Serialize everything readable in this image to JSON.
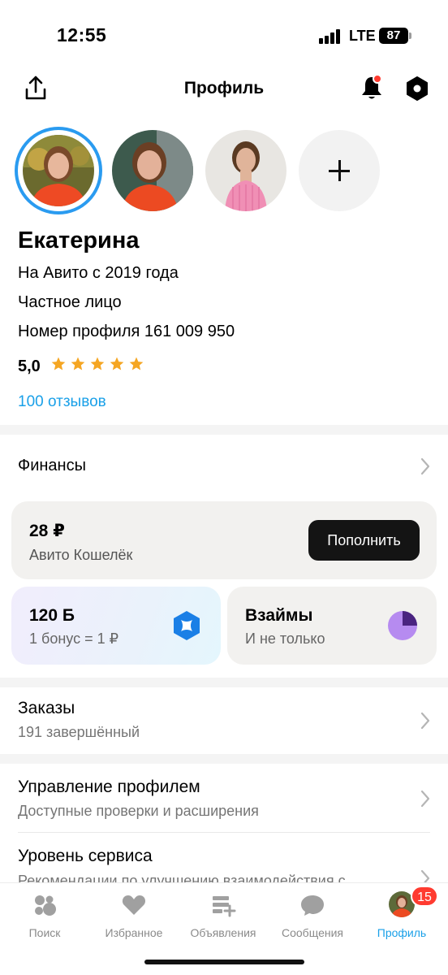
{
  "status_bar": {
    "time": "12:55",
    "network": "LTE",
    "battery": "87"
  },
  "header": {
    "title": "Профиль",
    "share_icon": "share-icon",
    "bell_icon": "bell-icon",
    "settings_icon": "gear-icon"
  },
  "profile": {
    "name": "Екатерина",
    "since": "На Авито с 2019 года",
    "type": "Частное лицо",
    "profile_number": "Номер профиля 161 009 950",
    "rating": "5,0",
    "stars": 5,
    "reviews": "100 отзывов"
  },
  "finance": {
    "title": "Финансы",
    "wallet": {
      "amount": "28 ₽",
      "label": "Авито Кошелёк",
      "button": "Пополнить"
    },
    "bonus": {
      "amount": "120 Б",
      "label": "1 бонус = 1 ₽"
    },
    "loans": {
      "title": "Взаймы",
      "label": "И не только"
    }
  },
  "orders": {
    "title": "Заказы",
    "subtitle": "191 завершённый"
  },
  "profile_management": {
    "title": "Управление профилем",
    "subtitle": "Доступные проверки и расширения"
  },
  "service_level": {
    "title": "Уровень сервиса",
    "subtitle": "Рекомендации по улучшению взаимодействия с"
  },
  "tab_bar": {
    "tabs": [
      {
        "label": "Поиск",
        "icon": "search-dots-icon"
      },
      {
        "label": "Избранное",
        "icon": "heart-icon"
      },
      {
        "label": "Объявления",
        "icon": "listings-add-icon"
      },
      {
        "label": "Сообщения",
        "icon": "chat-bubble-icon"
      },
      {
        "label": "Профиль",
        "icon": "avatar"
      }
    ],
    "badge": "15"
  },
  "colors": {
    "accent": "#1aa0e8",
    "star": "#f5a623",
    "badge": "#ff3b30"
  }
}
